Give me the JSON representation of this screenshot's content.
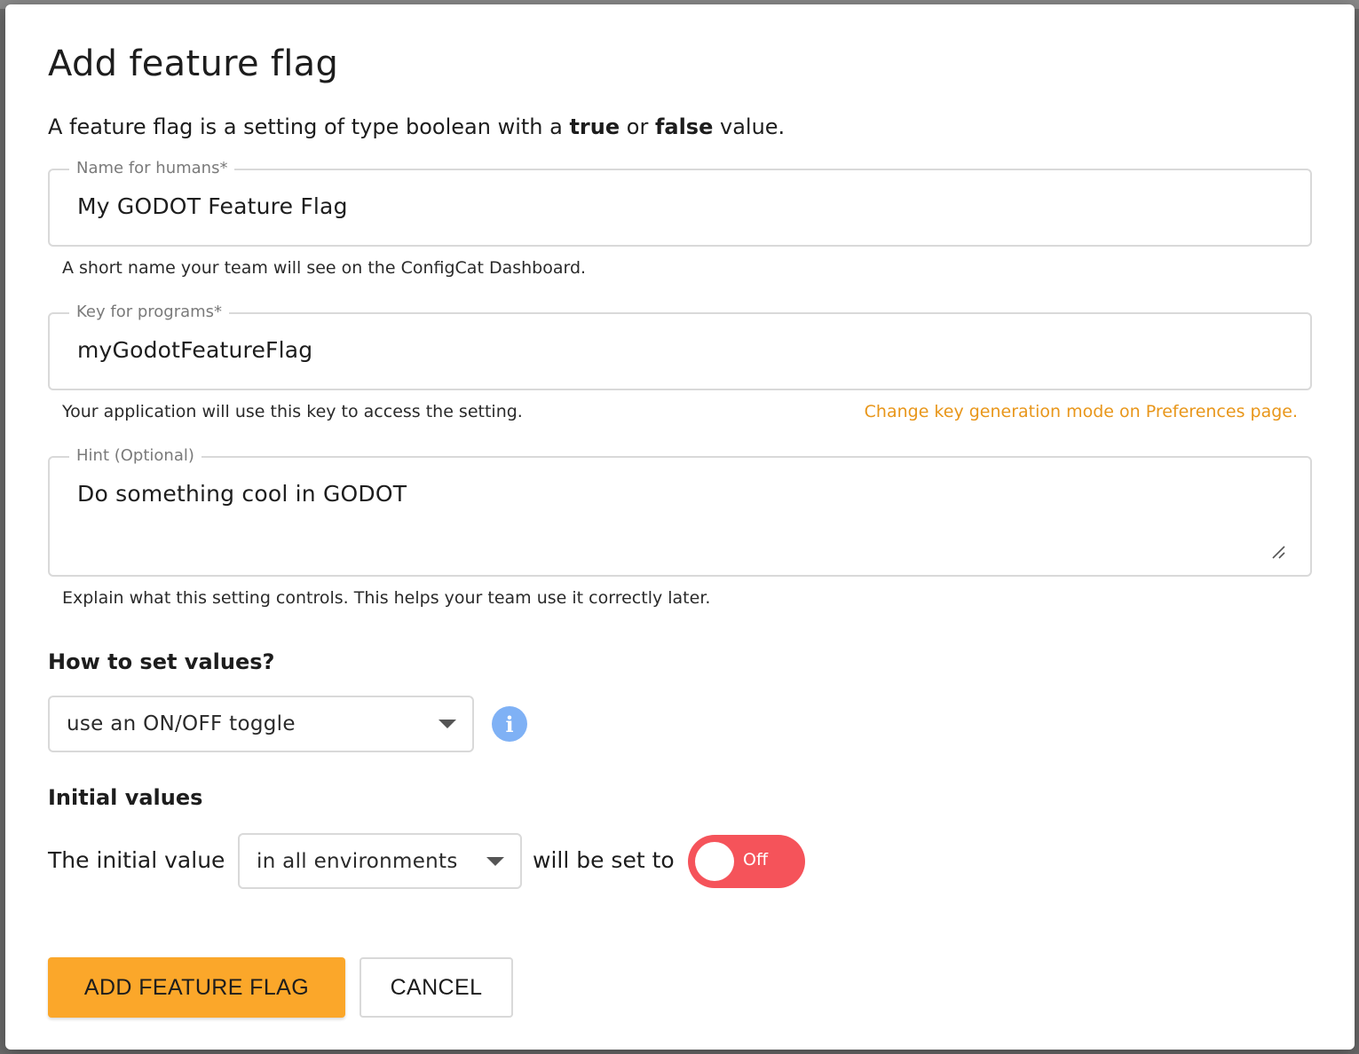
{
  "dialog": {
    "title": "Add feature flag",
    "intro": {
      "prefix": "A feature flag is a setting of type boolean with a ",
      "true_word": "true",
      "middle": " or ",
      "false_word": "false",
      "suffix": " value."
    }
  },
  "name_field": {
    "label": "Name for humans*",
    "value": "My GODOT Feature Flag",
    "helper": "A short name your team will see on the ConfigCat Dashboard."
  },
  "key_field": {
    "label": "Key for programs*",
    "value": "myGodotFeatureFlag",
    "helper": "Your application will use this key to access the setting.",
    "link": "Change key generation mode on Preferences page."
  },
  "hint_field": {
    "label": "Hint (Optional)",
    "value": "Do something cool in GODOT",
    "helper": "Explain what this setting controls. This helps your team use it correctly later."
  },
  "values_section": {
    "heading": "How to set values?",
    "select_value": "use an ON/OFF toggle",
    "info_icon": "info-icon"
  },
  "initial_section": {
    "heading": "Initial values",
    "prefix": "The initial value",
    "env_select_value": "in all environments",
    "middle": "will be set to",
    "toggle_label": "Off",
    "toggle_color": "#f5535a"
  },
  "actions": {
    "primary_label": "ADD FEATURE FLAG",
    "secondary_label": "CANCEL",
    "primary_color": "#fba72a",
    "link_color": "#e8961a"
  }
}
